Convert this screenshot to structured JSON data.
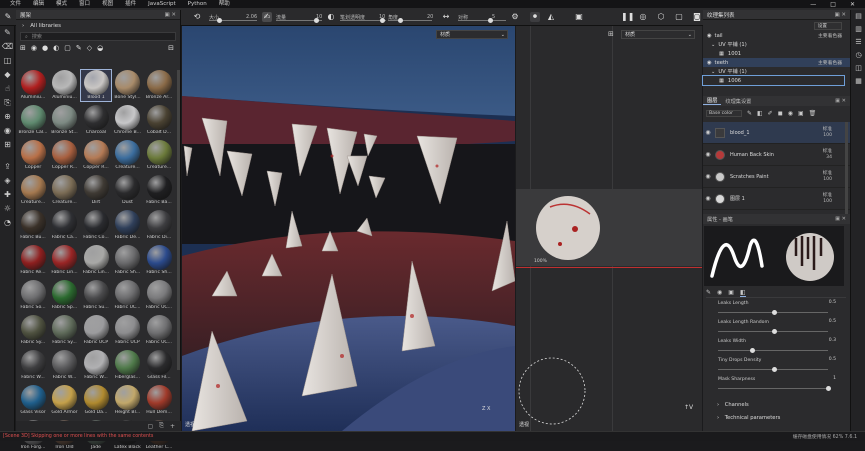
{
  "menu": [
    "文件",
    "编辑",
    "模式",
    "窗口",
    "视图",
    "插件",
    "JavaScript",
    "Python",
    "帮助"
  ],
  "window_controls": [
    "—",
    "□",
    "✕"
  ],
  "toolbar": {
    "size_label": "大小",
    "size_value": "2.06",
    "flow_label": "流量",
    "flow_value": "10",
    "stroke_opacity_label": "笔划透明度",
    "stroke_opacity_value": "10",
    "angle_label": "角度",
    "angle_value": "20",
    "extra_label": "对称",
    "extra_value": "5"
  },
  "shelf": {
    "title": "展架",
    "library": "All libraries",
    "search_placeholder": "搜索",
    "materials": [
      {
        "name": "Aluminiu...",
        "color": "#b01f1f"
      },
      {
        "name": "Aluminiu...",
        "color": "#b8b8b8"
      },
      {
        "name": "Blood 1",
        "color": "#c9c6c4"
      },
      {
        "name": "Bone Styl...",
        "color": "#a88b6a"
      },
      {
        "name": "Bronze Ar...",
        "color": "#8a6a47"
      },
      {
        "name": "Bronze Cal...",
        "color": "#5f8a6f"
      },
      {
        "name": "Bronze St...",
        "color": "#7d8a83"
      },
      {
        "name": "Charcoal",
        "color": "#2e2e30"
      },
      {
        "name": "Chrome B...",
        "color": "#c7c7c9"
      },
      {
        "name": "Cobalt D...",
        "color": "#4a4232"
      },
      {
        "name": "Copper",
        "color": "#b86f47"
      },
      {
        "name": "Copper R...",
        "color": "#a85f3f"
      },
      {
        "name": "Copper R...",
        "color": "#b47a55"
      },
      {
        "name": "Creature...",
        "color": "#3b6d9e"
      },
      {
        "name": "Creature...",
        "color": "#6b7a3a"
      },
      {
        "name": "Creature...",
        "color": "#a4784f"
      },
      {
        "name": "Creature...",
        "color": "#7b6c55"
      },
      {
        "name": "Dirt",
        "color": "#3f3a34"
      },
      {
        "name": "Dust",
        "color": "#2a2a2c"
      },
      {
        "name": "Fabric Ba...",
        "color": "#1f1f21"
      },
      {
        "name": "Fabric Bu...",
        "color": "#3a3129"
      },
      {
        "name": "Fabric Ca...",
        "color": "#2e2f33"
      },
      {
        "name": "Fabric Co...",
        "color": "#2a2b2f"
      },
      {
        "name": "Fabric De...",
        "color": "#2f3f5a"
      },
      {
        "name": "Fabric Di...",
        "color": "#3d3d40"
      },
      {
        "name": "Fabric Re...",
        "color": "#8e1f1f"
      },
      {
        "name": "Fabric Lin...",
        "color": "#9a2525"
      },
      {
        "name": "Fabric Lin...",
        "color": "#a8a8a6"
      },
      {
        "name": "Fabric Sh...",
        "color": "#6a6a6c"
      },
      {
        "name": "Fabric Sh...",
        "color": "#2b4a8c"
      },
      {
        "name": "Fabric So...",
        "color": "#6e6e70"
      },
      {
        "name": "Fabric Sp...",
        "color": "#2b6a2f"
      },
      {
        "name": "Fabric Su...",
        "color": "#4a4a4c"
      },
      {
        "name": "Fabric UC...",
        "color": "#6c6c6e"
      },
      {
        "name": "Fabric UC...",
        "color": "#7a7a7c"
      },
      {
        "name": "Fabric Sy...",
        "color": "#4f5240"
      },
      {
        "name": "Fabric Sy...",
        "color": "#5f6b5a"
      },
      {
        "name": "Fabric UCP",
        "color": "#9c9c9e"
      },
      {
        "name": "Fabric UCP",
        "color": "#8d8d8f"
      },
      {
        "name": "Fabric UC...",
        "color": "#6f6f71"
      },
      {
        "name": "Fabric W...",
        "color": "#3e3e40"
      },
      {
        "name": "Fabric W...",
        "color": "#5a5a5c"
      },
      {
        "name": "Fabric W...",
        "color": "#b0b0b2"
      },
      {
        "name": "Fiberglas...",
        "color": "#4f7a4a"
      },
      {
        "name": "Glass Fil...",
        "color": "#2a2a2c"
      },
      {
        "name": "Glass Visor",
        "color": "#1f5f8c"
      },
      {
        "name": "Gold Armor",
        "color": "#c4a04a"
      },
      {
        "name": "Gold Da...",
        "color": "#b08a2f"
      },
      {
        "name": "Height Bl...",
        "color": "#c2a86a"
      },
      {
        "name": "Hull Dem...",
        "color": "#a03a2a"
      },
      {
        "name": "Iron Forg...",
        "color": "#5a5a5c"
      },
      {
        "name": "Iron Old",
        "color": "#4a3a30"
      },
      {
        "name": "Jade",
        "color": "#3c4640"
      },
      {
        "name": "Latex Black",
        "color": "#1a1a1c"
      },
      {
        "name": "Leather C...",
        "color": "#3a2a22"
      }
    ]
  },
  "viewport3d": {
    "dropdown": "材质",
    "axis_label": "Z X",
    "corner_label": "透视"
  },
  "viewport2d": {
    "dropdown": "材质",
    "zoom": "100%",
    "corner_label": "透视"
  },
  "texture_sets": {
    "title": "纹理集列表",
    "settings_label": "设置",
    "items": [
      {
        "name": "tail",
        "shader": "主要着色器",
        "uv": "UV 平铺 (1)",
        "tile": "1001"
      },
      {
        "name": "teeth",
        "shader": "主要着色器",
        "uv": "UV 平铺 (1)",
        "tile": "1006"
      }
    ]
  },
  "layers": {
    "tab1": "图层",
    "tab2": "纹理集设置",
    "channel": "Base color",
    "items": [
      {
        "name": "blood_1",
        "blend": "标准",
        "opacity": "100",
        "thumb": "#3a3a3c"
      },
      {
        "name": "Human Back Skin",
        "blend": "标准",
        "opacity": "34",
        "thumb": "#b53a3a"
      },
      {
        "name": "Scratches Paint",
        "blend": "标准",
        "opacity": "100",
        "thumb": "#c9c9c9"
      },
      {
        "name": "图层 1",
        "blend": "标准",
        "opacity": "100",
        "thumb": "#d9d9d9"
      }
    ]
  },
  "properties": {
    "title": "属性 - 画笔",
    "params": [
      {
        "label": "Leaks Length",
        "value": "0.5",
        "pos": 0.5
      },
      {
        "label": "Leaks Length Random",
        "value": "0.5",
        "pos": 0.5
      },
      {
        "label": "Leaks Width",
        "value": "0.3",
        "pos": 0.3
      },
      {
        "label": "Tiny Drops Density",
        "value": "0.5",
        "pos": 0.5
      },
      {
        "label": "Mask Sharpness",
        "value": "1",
        "pos": 1.0
      }
    ],
    "sections": [
      "Channels",
      "Technical parameters"
    ]
  },
  "status": {
    "message": "[Scene 3D] Skipping one or more lines with the same contents",
    "right": "缓存磁盘使用情况  62%   7.6.1"
  }
}
